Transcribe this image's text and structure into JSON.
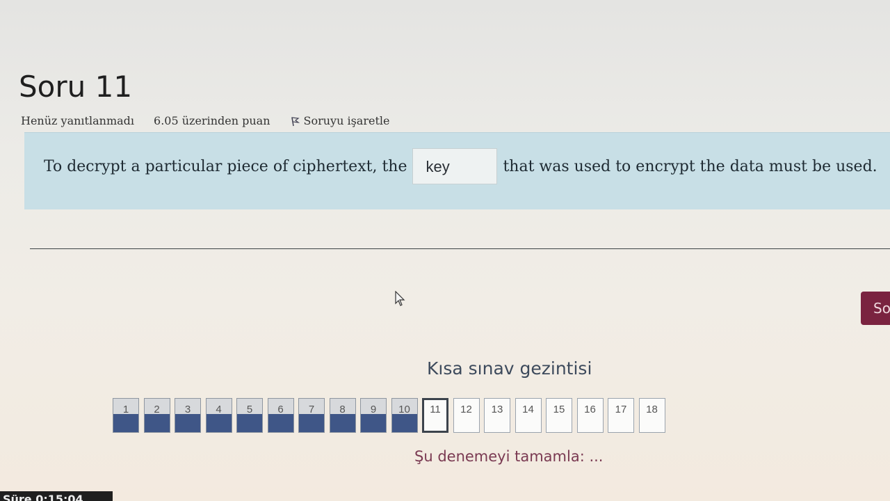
{
  "question": {
    "title": "Soru 11",
    "status": "Henüz yanıtlanmadı",
    "points": "6.05 üzerinden puan",
    "flag_label": "Soruyu işaretle",
    "text_before": "To decrypt a particular piece of ciphertext, the",
    "answer_value": "key",
    "text_after": "that was used to encrypt the data must be used."
  },
  "next_button_label": "So",
  "quiz_nav": {
    "title": "Kısa sınav gezintisi",
    "current": 11,
    "buttons": [
      {
        "label": "1",
        "state": "answered"
      },
      {
        "label": "2",
        "state": "answered"
      },
      {
        "label": "3",
        "state": "answered"
      },
      {
        "label": "4",
        "state": "answered"
      },
      {
        "label": "5",
        "state": "answered"
      },
      {
        "label": "6",
        "state": "answered"
      },
      {
        "label": "7",
        "state": "answered"
      },
      {
        "label": "8",
        "state": "answered"
      },
      {
        "label": "9",
        "state": "answered"
      },
      {
        "label": "10",
        "state": "answered"
      },
      {
        "label": "11",
        "state": "current"
      },
      {
        "label": "12",
        "state": "unanswered"
      },
      {
        "label": "13",
        "state": "unanswered"
      },
      {
        "label": "14",
        "state": "unanswered"
      },
      {
        "label": "15",
        "state": "unanswered"
      },
      {
        "label": "16",
        "state": "unanswered"
      },
      {
        "label": "17",
        "state": "unanswered"
      },
      {
        "label": "18",
        "state": "unanswered"
      }
    ],
    "finish_label": "Şu denemeyi tamamla: ..."
  },
  "timer_text": "Süre 0:15:04",
  "colors": {
    "question_bg": "#c8dfe6",
    "answered_fill": "#3f5687",
    "next_button": "#7a2340",
    "nav_title": "#3d4a5c",
    "finish_link": "#7a3a52"
  },
  "icons": [
    "flag-icon",
    "mouse-cursor-icon"
  ]
}
